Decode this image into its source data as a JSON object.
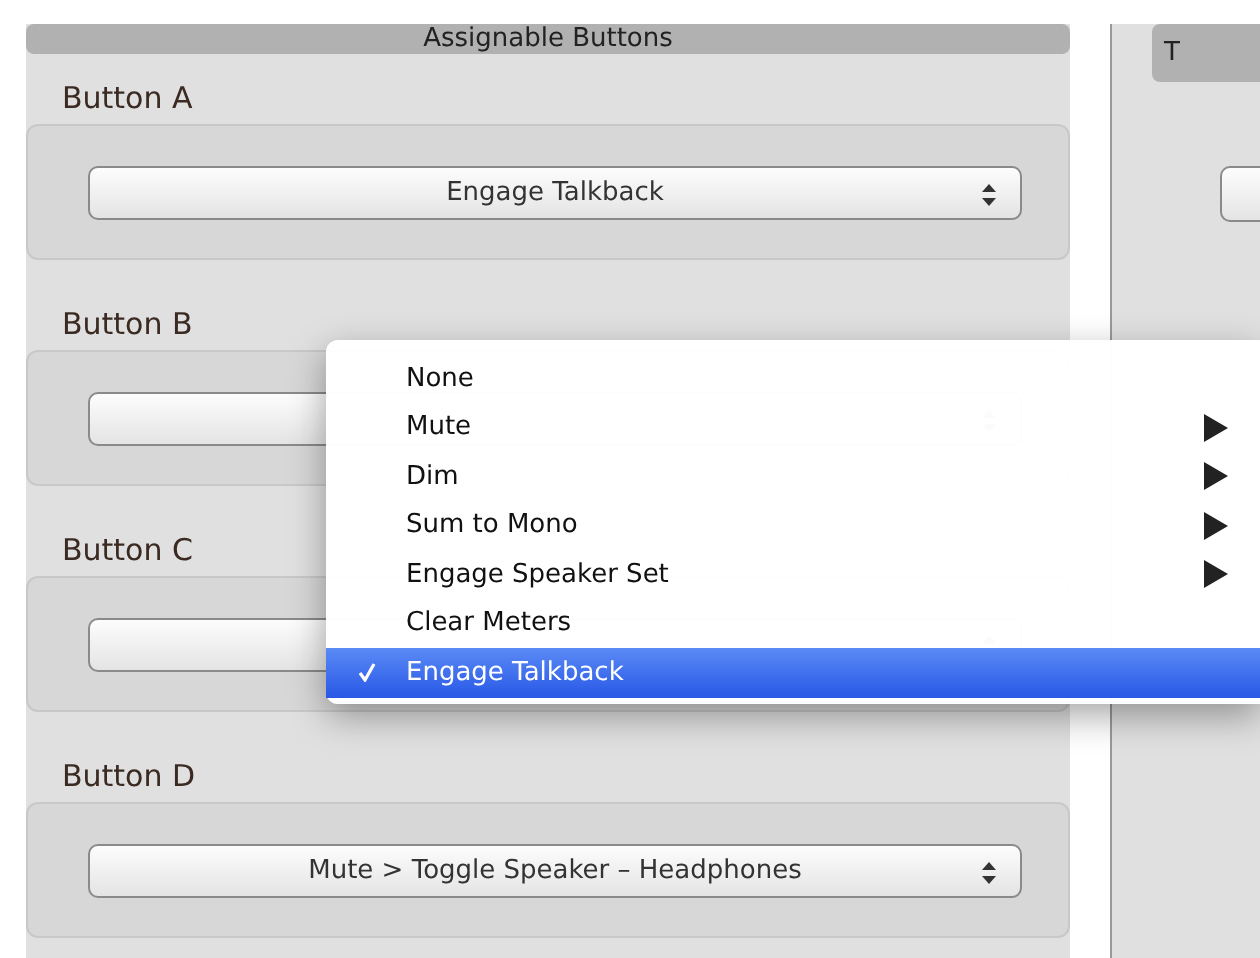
{
  "left_panel": {
    "header": "Assignable Buttons",
    "groups": [
      {
        "label": "Button A",
        "popup": {
          "value": "Engage Talkback"
        }
      },
      {
        "label": "Button B"
      },
      {
        "label": "Button C"
      },
      {
        "label": "Button D",
        "popup": {
          "value": "Mute > Toggle Speaker – Headphones"
        }
      }
    ]
  },
  "right_panel": {
    "header": "T"
  },
  "menu": {
    "items": [
      {
        "label": "None",
        "has_submenu": false,
        "selected": false
      },
      {
        "label": "Mute",
        "has_submenu": true,
        "selected": false
      },
      {
        "label": "Dim",
        "has_submenu": true,
        "selected": false
      },
      {
        "label": "Sum to Mono",
        "has_submenu": true,
        "selected": false
      },
      {
        "label": "Engage Speaker Set",
        "has_submenu": true,
        "selected": false
      },
      {
        "label": "Clear Meters",
        "has_submenu": false,
        "selected": false
      },
      {
        "label": "Engage Talkback",
        "has_submenu": false,
        "selected": true
      }
    ]
  }
}
